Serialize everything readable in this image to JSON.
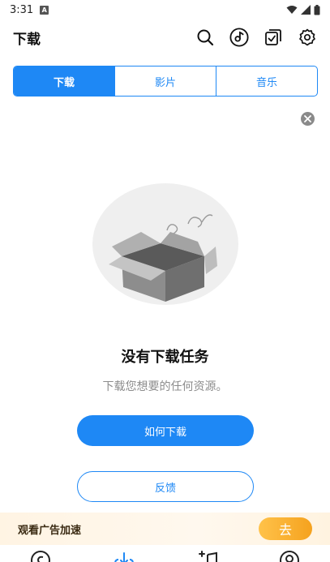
{
  "status_bar": {
    "time": "3:31",
    "app_badge": "A"
  },
  "header": {
    "title": "下载",
    "icons": [
      "search-icon",
      "music-disc-icon",
      "checklist-icon",
      "settings-icon"
    ]
  },
  "tabs": [
    {
      "label": "下载",
      "active": true
    },
    {
      "label": "影片",
      "active": false
    },
    {
      "label": "音乐",
      "active": false
    }
  ],
  "empty_state": {
    "title": "没有下载任务",
    "subtitle": "下载您想要的任何资源。",
    "primary_button": "如何下载",
    "secondary_button": "反馈"
  },
  "ad_banner": {
    "text": "观看广告加速",
    "button": "去"
  },
  "colors": {
    "accent": "#1E88F5",
    "ad_button": "#F5A21E"
  }
}
